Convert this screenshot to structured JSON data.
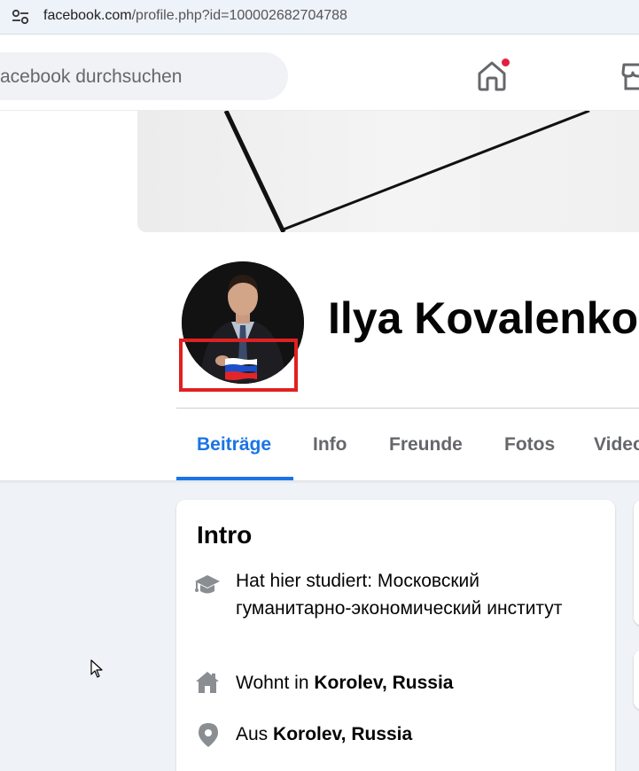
{
  "browser": {
    "url_host": "facebook.com",
    "url_path": "/profile.php?id=100002682704788"
  },
  "nav": {
    "search_placeholder": "acebook durchsuchen",
    "home_icon": "home-icon",
    "marketplace_icon": "store-icon",
    "notification_color": "#e41e3f"
  },
  "profile": {
    "name": "Ilya Kovalenko",
    "avatar_overlay": "russian-flag"
  },
  "tabs": [
    {
      "label": "Beiträge",
      "active": true
    },
    {
      "label": "Info",
      "active": false
    },
    {
      "label": "Freunde",
      "active": false
    },
    {
      "label": "Fotos",
      "active": false
    },
    {
      "label": "Video",
      "active": false
    }
  ],
  "intro": {
    "title": "Intro",
    "studied_prefix": "Hat hier studiert: ",
    "studied_value": "Московский гуманитарно-экономический институт",
    "lives_prefix": "Wohnt in ",
    "lives_value": "Korolev, Russia",
    "from_prefix": "Aus ",
    "from_value": "Korolev, Russia"
  },
  "colors": {
    "accent": "#1b74e4",
    "highlight_box": "#e02021",
    "page_bg": "#eff2f7"
  }
}
